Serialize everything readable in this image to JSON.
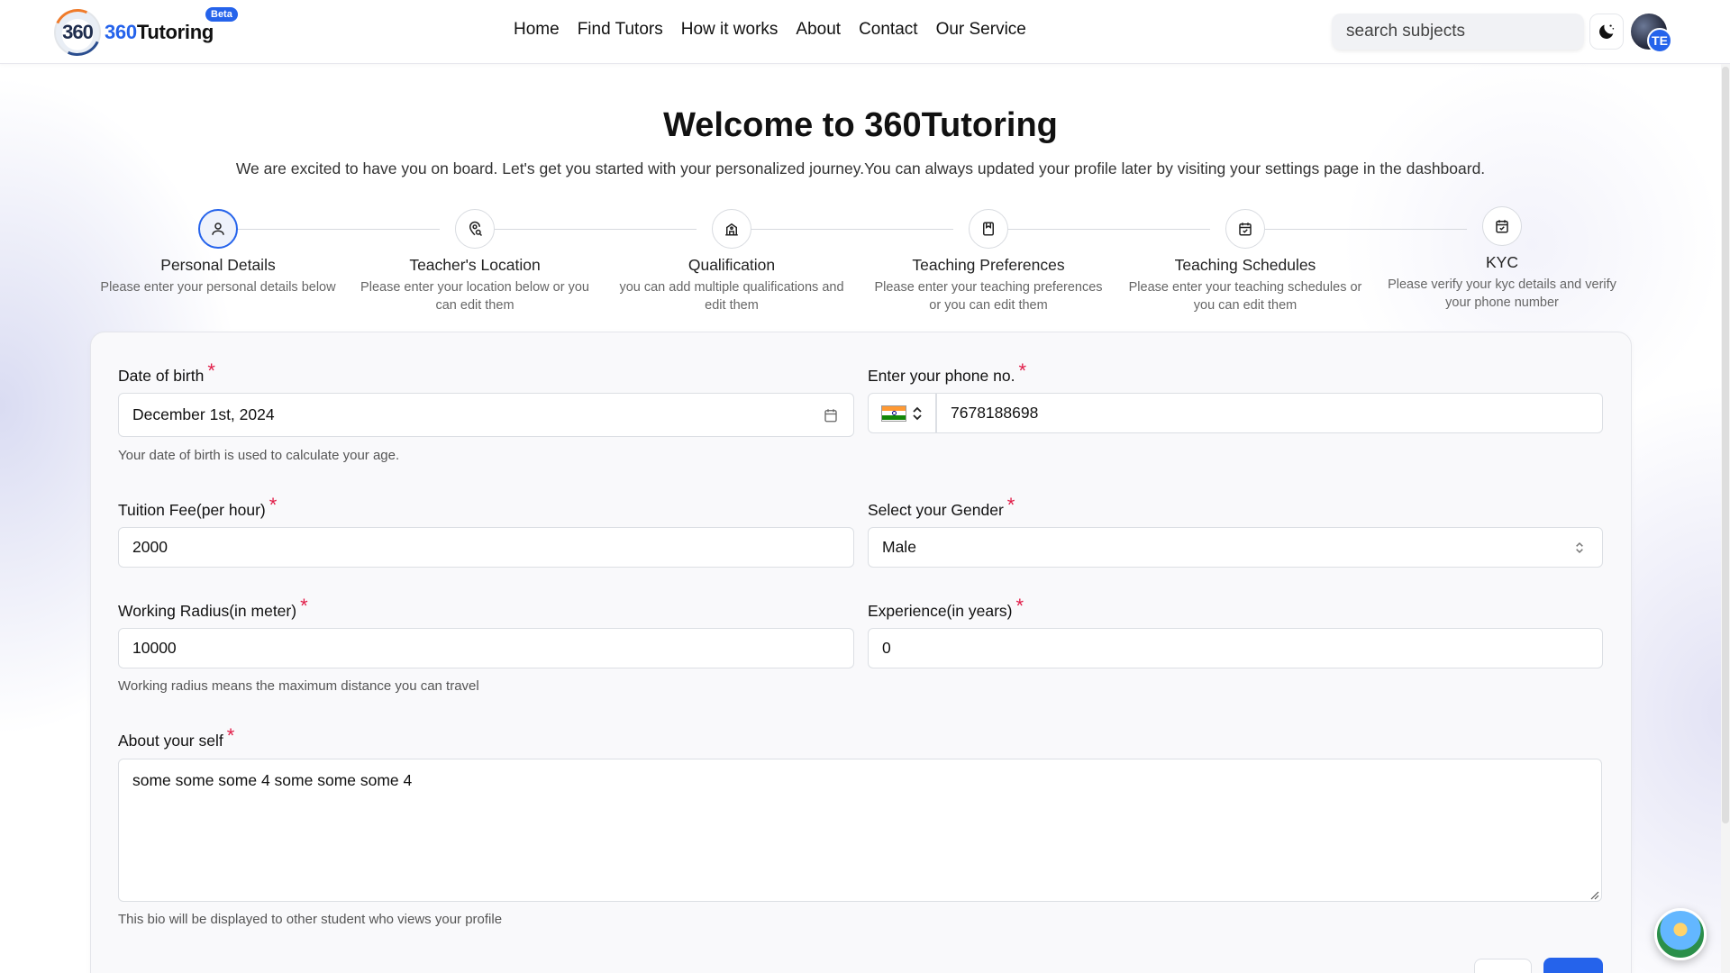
{
  "nav": {
    "logo_number": "360",
    "logo_brand_accent": "360",
    "logo_brand": "Tutoring",
    "beta_badge": "Beta",
    "links": [
      "Home",
      "Find Tutors",
      "How it works",
      "About",
      "Contact",
      "Our Service"
    ],
    "search_placeholder": "search subjects",
    "avatar_initials": "TE"
  },
  "header": {
    "title": "Welcome to 360Tutoring",
    "subtitle": "We are excited to have you on board. Let's get you started with your personalized journey.You can always updated your profile later by visiting your settings page in the dashboard."
  },
  "steps": [
    {
      "title": "Personal Details",
      "desc": "Please enter your personal details below",
      "icon": "user-icon",
      "active": true
    },
    {
      "title": "Teacher's Location",
      "desc": "Please enter your location below or you can edit them",
      "icon": "location-icon",
      "active": false
    },
    {
      "title": "Qualification",
      "desc": "you can add multiple qualifications and edit them",
      "icon": "school-icon",
      "active": false
    },
    {
      "title": "Teaching Preferences",
      "desc": "Please enter your teaching preferences or you can edit them",
      "icon": "bookmark-icon",
      "active": false
    },
    {
      "title": "Teaching Schedules",
      "desc": "Please enter your teaching schedules or you can edit them",
      "icon": "calendar-check-icon",
      "active": false
    },
    {
      "title": "KYC",
      "desc": "Please verify your kyc details and verify your phone number",
      "icon": "calendar-check-icon",
      "active": false
    }
  ],
  "form": {
    "dob": {
      "label": "Date of birth",
      "value": "December 1st, 2024",
      "hint": "Your date of birth is used to calculate your age."
    },
    "phone": {
      "label": "Enter your phone no.",
      "value": "7678188698"
    },
    "fee": {
      "label": "Tuition Fee(per hour)",
      "value": "2000"
    },
    "gender": {
      "label": "Select your Gender",
      "value": "Male"
    },
    "radius": {
      "label": "Working Radius(in meter)",
      "value": "10000",
      "hint": "Working radius means the maximum distance you can travel"
    },
    "experience": {
      "label": "Experience(in years)",
      "value": "0"
    },
    "about": {
      "label": "About your self",
      "value": "some some some 4 some some some 4",
      "hint": "This bio will be displayed to other student who views your profile"
    },
    "required_mark": "*"
  },
  "colors": {
    "accent": "#2563eb",
    "required": "#e11d48"
  }
}
